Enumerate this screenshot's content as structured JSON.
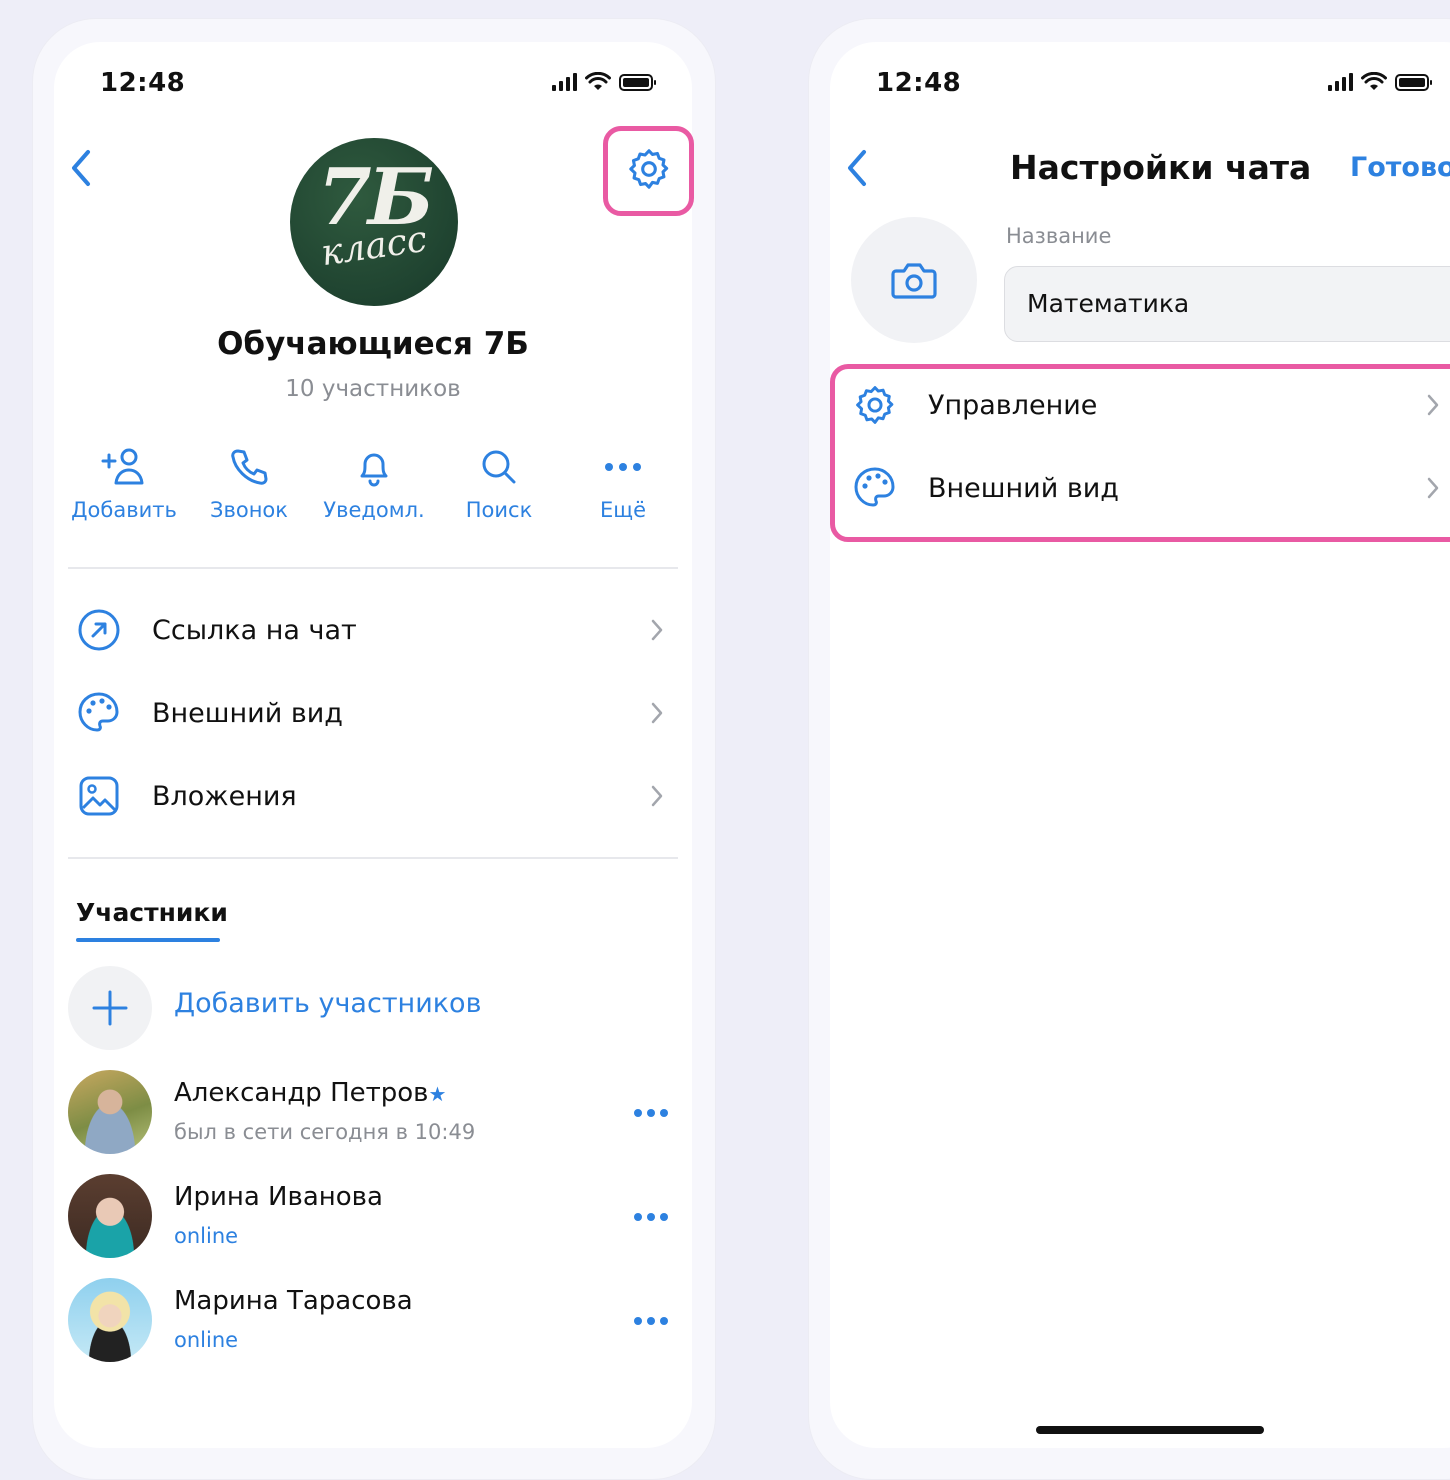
{
  "left": {
    "status_time": "12:48",
    "avatar_text_big": "7Б",
    "avatar_text_small": "класс",
    "chat_title": "Обучающиеся 7Б",
    "members_count": "10 участников",
    "actions": [
      {
        "label": "Добавить",
        "icon": "add-user-icon"
      },
      {
        "label": "Звонок",
        "icon": "phone-icon"
      },
      {
        "label": "Уведомл.",
        "icon": "bell-icon"
      },
      {
        "label": "Поиск",
        "icon": "search-icon"
      },
      {
        "label": "Ещё",
        "icon": "more-icon"
      }
    ],
    "menu": [
      {
        "label": "Ссылка на чат",
        "icon": "link-arrow-icon"
      },
      {
        "label": "Внешний вид",
        "icon": "palette-icon"
      },
      {
        "label": "Вложения",
        "icon": "image-icon"
      }
    ],
    "tab_members": "Участники",
    "add_members": "Добавить участников",
    "members": [
      {
        "name": "Александр Петров",
        "star": "★",
        "status": "был в сети сегодня в 10:49",
        "online": false
      },
      {
        "name": "Ирина Иванова",
        "status": "online",
        "online": true
      },
      {
        "name": "Марина Тарасова",
        "status": "online",
        "online": true
      }
    ]
  },
  "right": {
    "status_time": "12:48",
    "title": "Настройки чата",
    "done": "Готово",
    "field_label": "Название",
    "field_value": "Математика",
    "settings": [
      {
        "label": "Управление",
        "icon": "gear-icon"
      },
      {
        "label": "Внешний вид",
        "icon": "palette-icon"
      }
    ]
  },
  "colors": {
    "accent": "#2d81e0",
    "highlight": "#e95aa3",
    "online": "#2d81e0"
  }
}
